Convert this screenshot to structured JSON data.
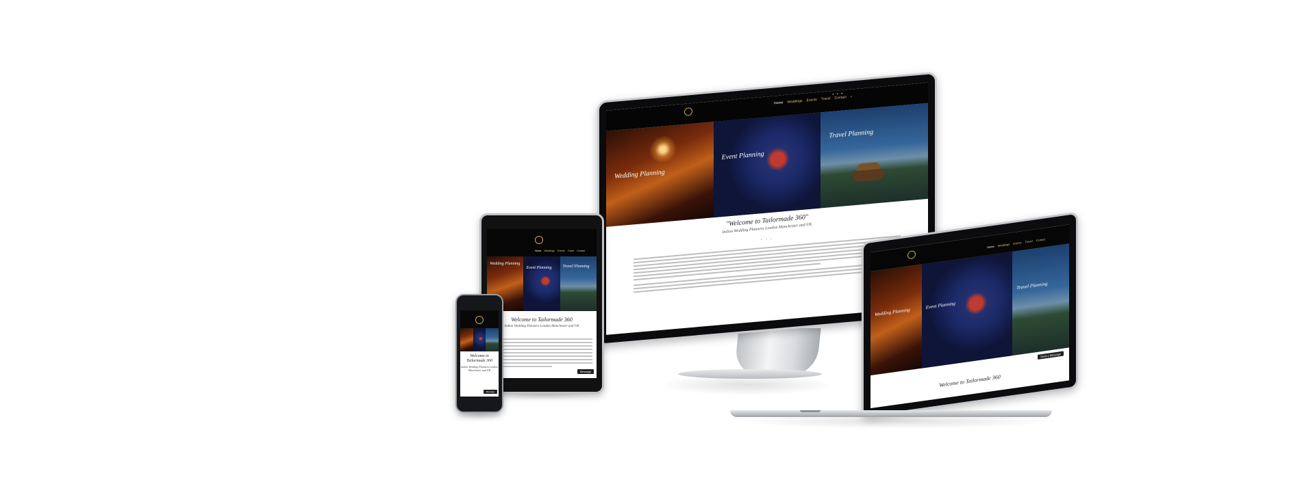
{
  "monitor": {
    "nav": [
      "Home",
      "Weddings",
      "Events",
      "Travel",
      "Contact"
    ],
    "hero_panels": [
      {
        "title": "Wedding Planning",
        "color": "#c0601a"
      },
      {
        "title": "Event Planning",
        "color": "#24306e"
      },
      {
        "title": "Travel Planning",
        "color": "#35669a"
      }
    ],
    "welcome": "\"Welcome to Tailormade 360\"",
    "subtitle": "Indian Wedding Planners London Manchester and UK"
  },
  "tablet": {
    "nav": [
      "Home",
      "Weddings",
      "Events",
      "Travel",
      "Contact"
    ],
    "hero_panels": [
      {
        "title": "Wedding Planning"
      },
      {
        "title": "Event Planning"
      },
      {
        "title": "Travel Planning"
      }
    ],
    "welcome": "Welcome to Tailormade 360",
    "subtitle": "Indian Wedding Planners London Manchester and UK",
    "message_button": "Message"
  },
  "phone": {
    "welcome": "Welcome to Tailormade 360",
    "subtitle": "Indian Wedding Planners London Manchester and UK",
    "message_button": "Message"
  },
  "laptop": {
    "nav": [
      "Home",
      "Weddings",
      "Events",
      "Travel",
      "Contact"
    ],
    "hero_panels": [
      {
        "title": "Wedding Planning"
      },
      {
        "title": "Event Planning"
      },
      {
        "title": "Travel Planning"
      }
    ],
    "welcome": "Welcome to Tailormade 360",
    "message_button": "Send a Message"
  },
  "colors": {
    "gold": "#c9a85a",
    "dark": "#050505"
  }
}
